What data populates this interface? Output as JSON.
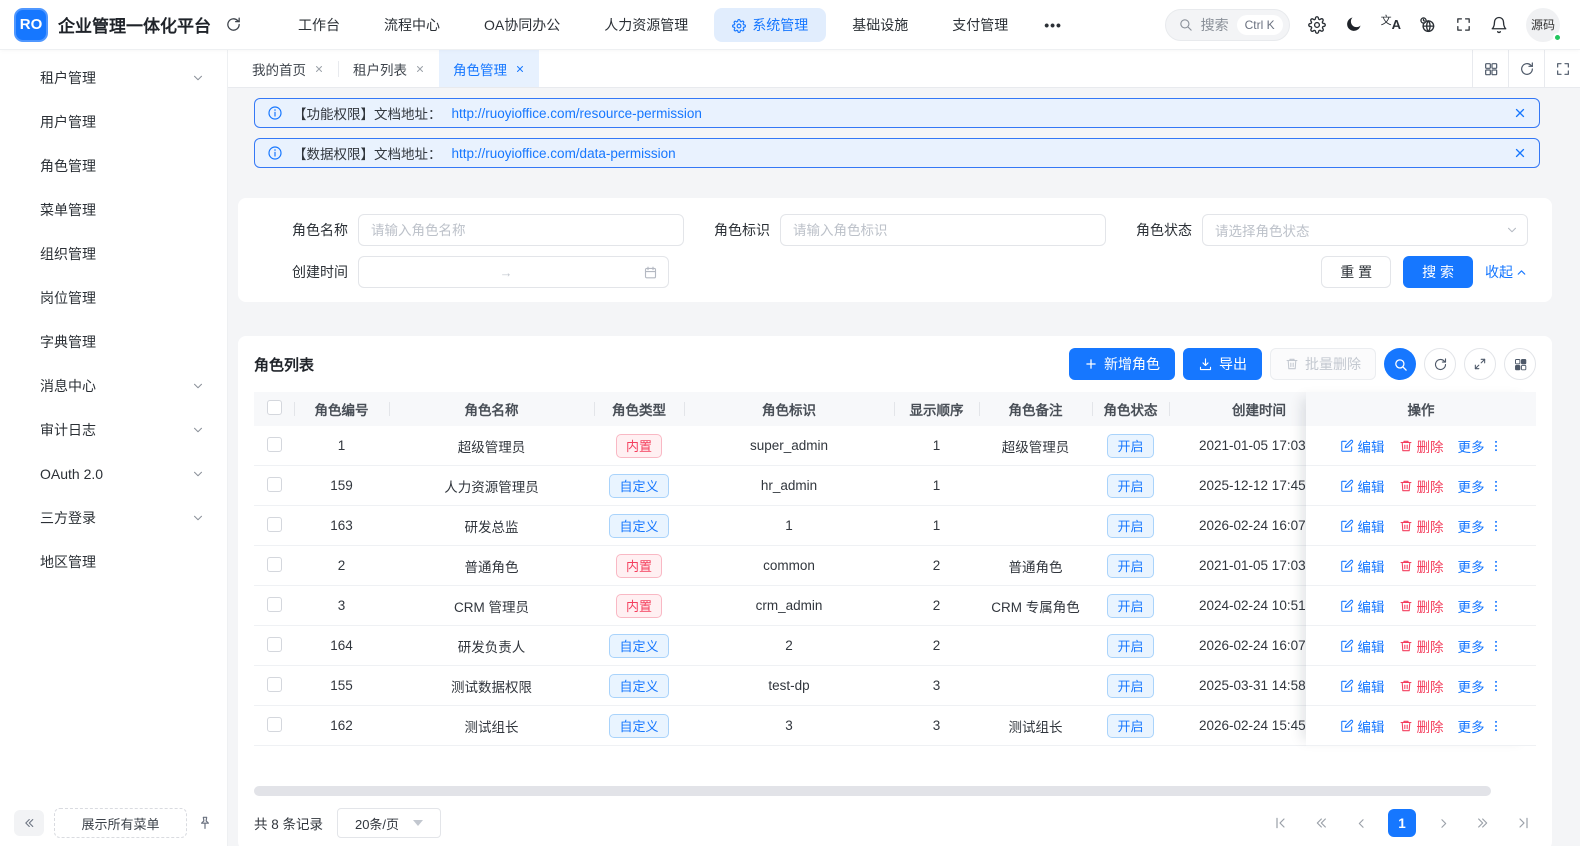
{
  "navbar": {
    "logo_text": "RO",
    "title": "企业管理一体化平台",
    "menu": [
      {
        "label": "工作台"
      },
      {
        "label": "流程中心"
      },
      {
        "label": "OA协同办公"
      },
      {
        "label": "人力资源管理"
      },
      {
        "label": "系统管理",
        "active": true
      },
      {
        "label": "基础设施"
      },
      {
        "label": "支付管理"
      }
    ],
    "more_label": "•••",
    "search": {
      "placeholder": "搜索",
      "shortcut": "Ctrl K"
    },
    "user": {
      "name": "源码"
    }
  },
  "sidebar": {
    "items": [
      {
        "label": "租户管理",
        "expandable": true
      },
      {
        "label": "用户管理"
      },
      {
        "label": "角色管理"
      },
      {
        "label": "菜单管理"
      },
      {
        "label": "组织管理"
      },
      {
        "label": "岗位管理"
      },
      {
        "label": "字典管理"
      },
      {
        "label": "消息中心",
        "expandable": true
      },
      {
        "label": "审计日志",
        "expandable": true
      },
      {
        "label": "OAuth 2.0",
        "expandable": true
      },
      {
        "label": "三方登录",
        "expandable": true
      },
      {
        "label": "地区管理"
      }
    ],
    "footer": {
      "show_all_label": "展示所有菜单"
    }
  },
  "tabs": [
    {
      "label": "我的首页"
    },
    {
      "label": "租户列表"
    },
    {
      "label": "角色管理",
      "active": true
    }
  ],
  "alerts": [
    {
      "prefix": "【功能权限】文档地址：",
      "url": "http://ruoyioffice.com/resource-permission"
    },
    {
      "prefix": "【数据权限】文档地址：",
      "url": "http://ruoyioffice.com/data-permission"
    }
  ],
  "search_form": {
    "name_label": "角色名称",
    "name_placeholder": "请输入角色名称",
    "key_label": "角色标识",
    "key_placeholder": "请输入角色标识",
    "status_label": "角色状态",
    "status_placeholder": "请选择角色状态",
    "time_label": "创建时间",
    "time_range_separator": "→",
    "reset_label": "重 置",
    "search_label": "搜 索",
    "collapse_label": "收起"
  },
  "table": {
    "title": "角色列表",
    "toolbar": {
      "add": "新增角色",
      "export": "导出",
      "batch_delete": "批量删除"
    },
    "columns": [
      "角色编号",
      "角色名称",
      "角色类型",
      "角色标识",
      "显示顺序",
      "角色备注",
      "角色状态",
      "创建时间",
      "操作"
    ],
    "actions": {
      "edit": "编辑",
      "delete": "删除",
      "more": "更多"
    },
    "rows": [
      {
        "id": "1",
        "name": "超级管理员",
        "type": "内置",
        "type_kind": "builtin",
        "key": "super_admin",
        "order": "1",
        "remark": "超级管理员",
        "status": "开启",
        "created": "2021-01-05 17:03"
      },
      {
        "id": "159",
        "name": "人力资源管理员",
        "type": "自定义",
        "type_kind": "custom",
        "key": "hr_admin",
        "order": "1",
        "remark": "",
        "status": "开启",
        "created": "2025-12-12 17:45"
      },
      {
        "id": "163",
        "name": "研发总监",
        "type": "自定义",
        "type_kind": "custom",
        "key": "1",
        "order": "1",
        "remark": "",
        "status": "开启",
        "created": "2026-02-24 16:07"
      },
      {
        "id": "2",
        "name": "普通角色",
        "type": "内置",
        "type_kind": "builtin",
        "key": "common",
        "order": "2",
        "remark": "普通角色",
        "status": "开启",
        "created": "2021-01-05 17:03"
      },
      {
        "id": "3",
        "name": "CRM 管理员",
        "type": "内置",
        "type_kind": "builtin",
        "key": "crm_admin",
        "order": "2",
        "remark": "CRM 专属角色",
        "status": "开启",
        "created": "2024-02-24 10:51"
      },
      {
        "id": "164",
        "name": "研发负责人",
        "type": "自定义",
        "type_kind": "custom",
        "key": "2",
        "order": "2",
        "remark": "",
        "status": "开启",
        "created": "2026-02-24 16:07"
      },
      {
        "id": "155",
        "name": "测试数据权限",
        "type": "自定义",
        "type_kind": "custom",
        "key": "test-dp",
        "order": "3",
        "remark": "",
        "status": "开启",
        "created": "2025-03-31 14:58"
      },
      {
        "id": "162",
        "name": "测试组长",
        "type": "自定义",
        "type_kind": "custom",
        "key": "3",
        "order": "3",
        "remark": "测试组长",
        "status": "开启",
        "created": "2026-02-24 15:45"
      }
    ]
  },
  "pagination": {
    "total_label": "共 8 条记录",
    "page_size": "20条/页",
    "page": "1"
  },
  "colors": {
    "primary": "#1677ff",
    "danger": "#f43f5e",
    "alert_bg": "#e9f2fe",
    "badge_red_bg": "#fff0f2",
    "badge_blue_bg": "#e9f4ff",
    "header_bg": "#f7f8fa"
  }
}
